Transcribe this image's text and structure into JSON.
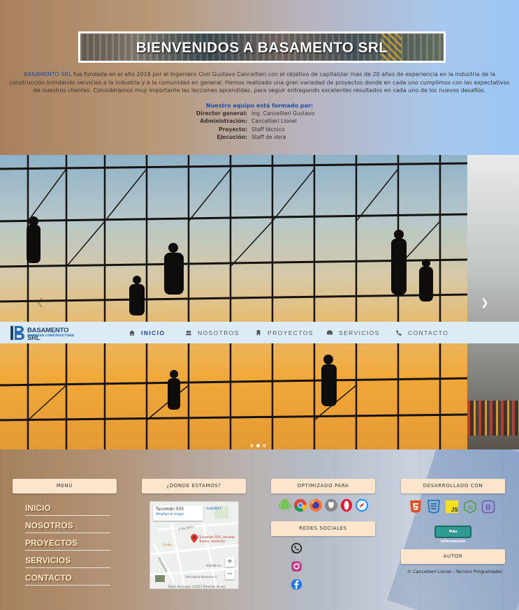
{
  "intro": {
    "banner_title": "BIENVENIDOS A BASAMENTO SRL",
    "brand": "BASAMENTO SRL",
    "description": " fue fundada en el año 2018 por el Ingeniero Civil Gustavo Cancellieri con el objetivo de capitalizar mas de 20 años de experiencia en la industria de la construcción brindando servicios a la industria y a la comunidad en general. Hemos realizado una gran variedad de proyectos donde en cada uno cumplimos con las expectativas de nuestros clientes. Consideramos muy importante las lecciones aprendidas, para seguir entregando excelentes resultados en cada uno de los nuevos desafíos.",
    "team_title": "Nuestro equipo está formado por:",
    "team": [
      {
        "role": "Director general:",
        "name": "Ing. Cancellieri Gustavo"
      },
      {
        "role": "Administración:",
        "name": "Cancellieri Lionel"
      },
      {
        "role": "Proyecto:",
        "name": "Staff técnico"
      },
      {
        "role": "Ejecución:",
        "name": "Staff de obra"
      }
    ]
  },
  "carousel": {
    "next_icon": "chevron-right-icon",
    "prev_icon": "chevron-left-icon",
    "slides": 3,
    "active": 1
  },
  "navbar": {
    "logo_name": "BASAMENTO SRL",
    "logo_sub": "EMPRESA CONSTRUCTORA",
    "items": [
      {
        "label": "INICIO",
        "icon": "home-icon"
      },
      {
        "label": "NOSOTROS",
        "icon": "users-icon"
      },
      {
        "label": "PROYECTOS",
        "icon": "bookmark-icon"
      },
      {
        "label": "SERVICIOS",
        "icon": "truck-icon"
      },
      {
        "label": "CONTACTO",
        "icon": "phone-icon"
      }
    ],
    "active_color": "#1f3f8a"
  },
  "footer": {
    "menu_title": "MENÚ",
    "menu": [
      "INICIO",
      "NOSOTROS",
      "PROYECTOS",
      "SERVICIOS",
      "CONTACTO"
    ],
    "location_title": "¿DONDE ESTAMOS?",
    "map": {
      "address": "Tucumán 555",
      "enlarge": "Ampliar el mapa",
      "pin_label": "Tucumán 555, Venado Tuerto, Santa Fe",
      "places": [
        "XeNONVT",
        "Grido",
        "AXION en",
        "Parroquia Nuestra S"
      ],
      "streets": [
        "2 de Abril",
        "Rivadavia"
      ],
      "attribution": "Datos de mapas ©2023   Términos de uso"
    },
    "optimized_title": "OPTIMIZADO PARA",
    "browsers": [
      "android-icon",
      "chrome-icon",
      "firefox-icon",
      "apple-icon",
      "opera-icon",
      "safari-icon"
    ],
    "social_title": "REDES SOCIALES",
    "social": [
      "whatsapp-icon",
      "instagram-icon",
      "facebook-icon"
    ],
    "developed_title": "DESARROLLADO CON",
    "tech": [
      "html5-icon",
      "css3-icon",
      "javascript-icon",
      "nodejs-icon",
      "bootstrap-icon"
    ],
    "more_button": "Más información",
    "author_title": "AUTOR",
    "copyright": "© Cancellieri Lionel - Técnico Programador"
  }
}
